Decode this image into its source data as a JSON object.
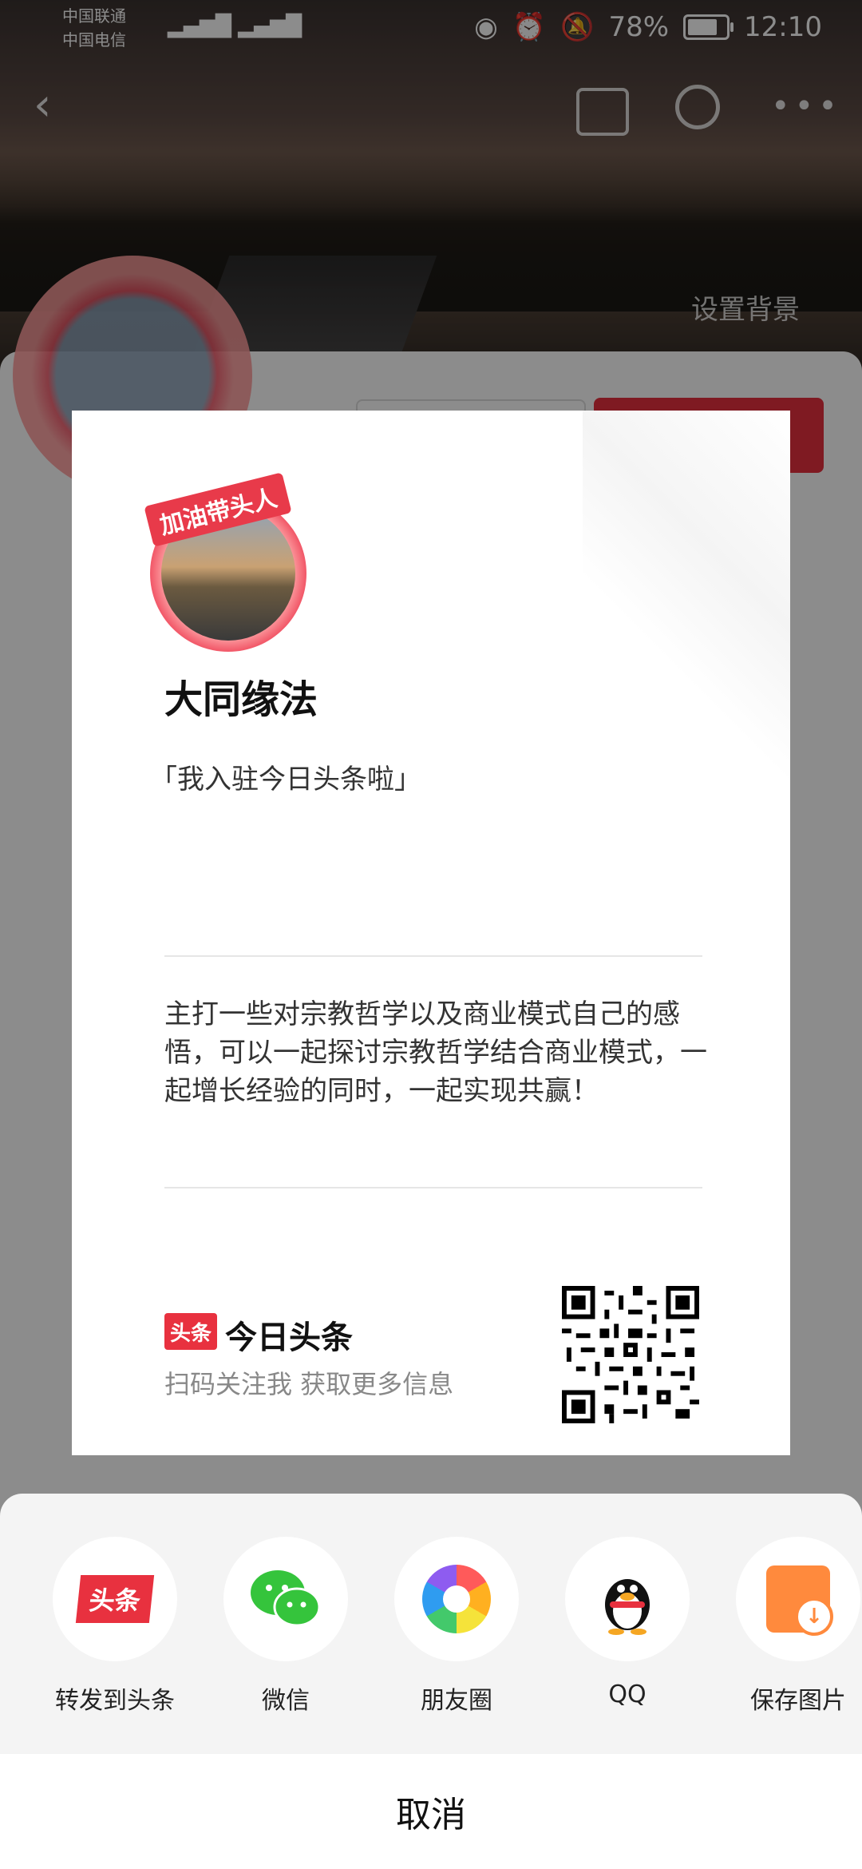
{
  "status_bar": {
    "carrier1": "中国联通",
    "carrier2": "中国电信",
    "battery_pct": "78%",
    "time": "12:10",
    "battery_level": 0.78
  },
  "header": {
    "set_background": "设置背景"
  },
  "card": {
    "badge": "加油带头人",
    "name": "大同缘法",
    "slogan": "「我入驻今日头条啦」",
    "bio": "主打一些对宗教哲学以及商业模式自己的感悟，可以一起探讨宗教哲学结合商业模式，一起增长经验的同时，一起实现共赢！",
    "brand_logo": "头条",
    "brand_name": "今日头条",
    "scan_text": "扫码关注我 获取更多信息"
  },
  "share": {
    "items": [
      {
        "label": "转发到头条",
        "icon": "toutiao-icon"
      },
      {
        "label": "微信",
        "icon": "wechat-icon"
      },
      {
        "label": "朋友圈",
        "icon": "moments-icon"
      },
      {
        "label": "QQ",
        "icon": "qq-icon"
      },
      {
        "label": "保存图片",
        "icon": "save-image-icon"
      }
    ],
    "cancel": "取消"
  },
  "colors": {
    "accent": "#e8313f",
    "sheet_bg": "#f4f4f4"
  }
}
